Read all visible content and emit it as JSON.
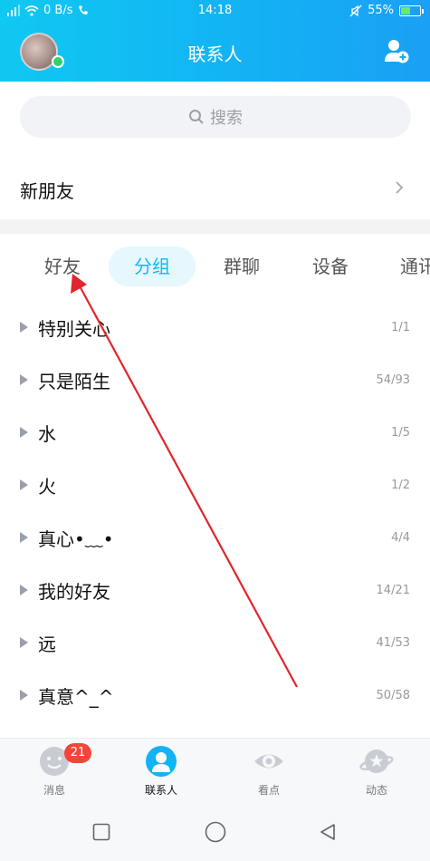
{
  "status_bar": {
    "network_speed": "0 B/s",
    "time": "14:18",
    "battery": "55%",
    "battery_level": 0.55
  },
  "header": {
    "title": "联系人"
  },
  "search": {
    "placeholder": "搜索"
  },
  "new_friends": {
    "label": "新朋友"
  },
  "tabs": [
    {
      "label": "好友"
    },
    {
      "label": "分组"
    },
    {
      "label": "群聊"
    },
    {
      "label": "设备"
    },
    {
      "label": "通讯"
    }
  ],
  "active_tab": "分组",
  "groups": [
    {
      "name": "特别关心",
      "count": "1/1"
    },
    {
      "name": "只是陌生",
      "count": "54/93"
    },
    {
      "name": "水",
      "count": "1/5"
    },
    {
      "name": "火",
      "count": "1/2"
    },
    {
      "name": "真心•﹏•",
      "count": "4/4"
    },
    {
      "name": "我的好友",
      "count": "14/21"
    },
    {
      "name": "远",
      "count": "41/53"
    },
    {
      "name": "真意^_^",
      "count": "50/58"
    }
  ],
  "bottom_nav": {
    "messages": {
      "label": "消息",
      "badge": "21",
      "icon": "chat-face-icon"
    },
    "contacts": {
      "label": "联系人",
      "icon": "person-icon"
    },
    "discover": {
      "label": "看点",
      "icon": "eye-icon"
    },
    "moments": {
      "label": "动态",
      "icon": "planet-star-icon"
    }
  },
  "colors": {
    "header_gradient_start": "#10c8f2",
    "header_gradient_end": "#1aa0f5",
    "accent": "#12b7f5",
    "badge": "#f2463a",
    "annotation_arrow": "#e0252b"
  }
}
